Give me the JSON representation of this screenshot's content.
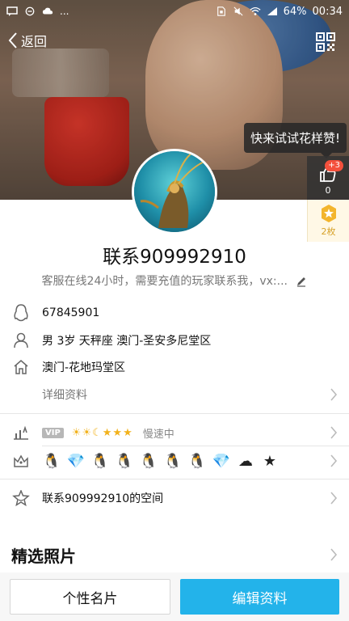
{
  "status_bar": {
    "battery": "64%",
    "time": "00:34",
    "left_icons": [
      "message-icon",
      "minus-circle-icon",
      "cloud-icon",
      "more-dots"
    ],
    "right_icons": [
      "sim-icon",
      "mute-icon",
      "wifi-icon",
      "signal-icon"
    ]
  },
  "header": {
    "back_label": "返回",
    "qr_icon": "qr-code-icon"
  },
  "tooltip": "快来试试花样赞!",
  "likes": {
    "badge": "+3",
    "count": "0"
  },
  "medal": {
    "count_label": "2枚"
  },
  "profile": {
    "nickname": "联系909992910",
    "signature": "客服在线24小时，需要充值的玩家联系我，vx:..."
  },
  "info": {
    "qq_number": "67845901",
    "details": "男  3岁  天秤座  澳门-圣安多尼堂区",
    "hometown": "澳门-花地玛堂区",
    "more_label": "详细资料"
  },
  "vip": {
    "tag": "VIP",
    "level_icons": "☀☀☾★★★",
    "speed": "慢速中"
  },
  "badges": [
    "🐧",
    "💎",
    "🐧",
    "🐧",
    "🐧",
    "🐧",
    "🐧",
    "💎",
    "☁",
    "★"
  ],
  "space": {
    "label": "联系909992910的空间"
  },
  "photos": {
    "title": "精选照片"
  },
  "bottom": {
    "card_label": "个性名片",
    "edit_label": "编辑资料"
  },
  "colors": {
    "accent": "#23b3ea",
    "badge_red": "#f4503c",
    "medal_gold": "#d7a22a"
  }
}
